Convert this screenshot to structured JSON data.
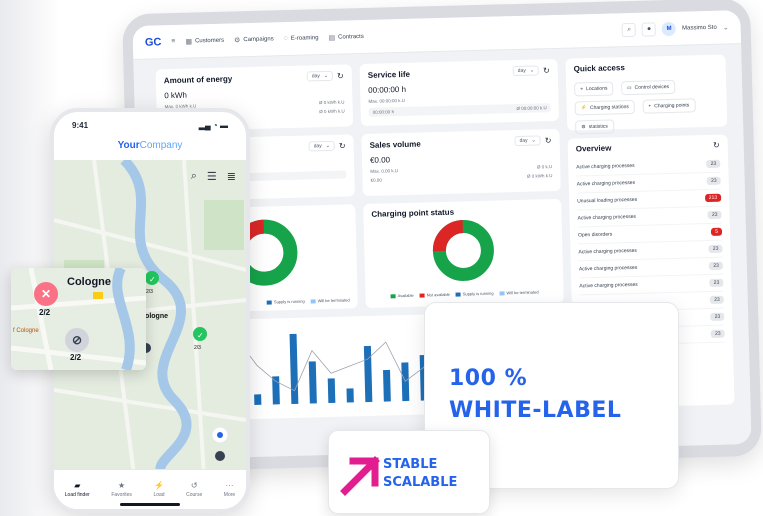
{
  "dashboard": {
    "logo": "GC",
    "nav": [
      "Customers",
      "Campaigns",
      "E-roaming",
      "Contracts"
    ],
    "user": {
      "initial": "M",
      "name": "Massimo Sto"
    },
    "energy": {
      "title": "Amount of energy",
      "value": "0 kWh",
      "filter": "day",
      "max_label": "Max. 0 kWh k.U",
      "avg1": "Ø 0 kWh k.U",
      "avg2": "Ø 0 kWh k.U"
    },
    "service": {
      "title": "Service life",
      "value": "00:00:00 h",
      "filter": "day",
      "max_label": "Max. 00:00:00 k.U",
      "sub": "00:00:00 h",
      "avg1": "Ø 00:00:00 k.U",
      "avg2": "Ø 00:00:00 k.U"
    },
    "quick": {
      "title": "Quick access",
      "items": [
        "Locations",
        "Control devices",
        "Charging stations",
        "Charging points",
        "statistics"
      ]
    },
    "second_filter": "day",
    "sales": {
      "title": "Sales volume",
      "value": "€0.00",
      "filter": "day",
      "max_label": "Max. 0.00 k.U",
      "avg1": "Ø 0 k.U",
      "sub": "€0.00",
      "avg2": "Ø 0 kWh k.U"
    },
    "status": {
      "title": "Charging point status",
      "legend": [
        "Available",
        "Not available",
        "Supply is running",
        "Will be terminated"
      ]
    },
    "left_legend": [
      "Supply is running",
      "Will be terminated"
    ],
    "overview": {
      "title": "Overview",
      "rows": [
        {
          "label": "Active charging processes",
          "count": "23",
          "alert": false
        },
        {
          "label": "Active charging processes",
          "count": "23",
          "alert": false
        },
        {
          "label": "Unusual loading processes",
          "count": "213",
          "alert": true
        },
        {
          "label": "Active charging processes",
          "count": "23",
          "alert": false
        },
        {
          "label": "Open disorders",
          "count": "5",
          "alert": true
        },
        {
          "label": "Active charging processes",
          "count": "23",
          "alert": false
        },
        {
          "label": "Active charging processes",
          "count": "23",
          "alert": false
        },
        {
          "label": "Active charging processes",
          "count": "23",
          "alert": false
        }
      ],
      "extra_counts": [
        "23",
        "23",
        "23"
      ]
    },
    "bar_chart": {
      "type": "bar",
      "values": [
        6,
        9,
        14,
        5,
        3,
        8,
        20,
        12,
        7,
        4,
        16,
        9,
        11,
        13,
        18,
        6,
        10,
        15,
        19,
        8
      ]
    }
  },
  "white_label": {
    "line1": "100 %",
    "line2": "WHITE-LABEL"
  },
  "stable": {
    "line1": "STABLE",
    "line2": "SCALABLE"
  },
  "phone": {
    "time": "9:41",
    "brand_bold": "Your",
    "brand_light": "Company",
    "map_labels": {
      "city": "Cologne",
      "pin1": "2/2",
      "pin2": "2/3",
      "pin3": "2/3"
    },
    "tabs": [
      "Load finder",
      "Favorites",
      "Load",
      "Course",
      "More"
    ]
  },
  "popup": {
    "city": "Cologne",
    "pin_red_label": "2/2",
    "pin_grey_label": "2/2",
    "side_label": "f Cologne"
  },
  "colors": {
    "accent": "#2563eb",
    "green": "#16a34a",
    "red": "#dc2626",
    "blue_bar": "#1d6fb8",
    "magenta": "#e11d8f"
  }
}
